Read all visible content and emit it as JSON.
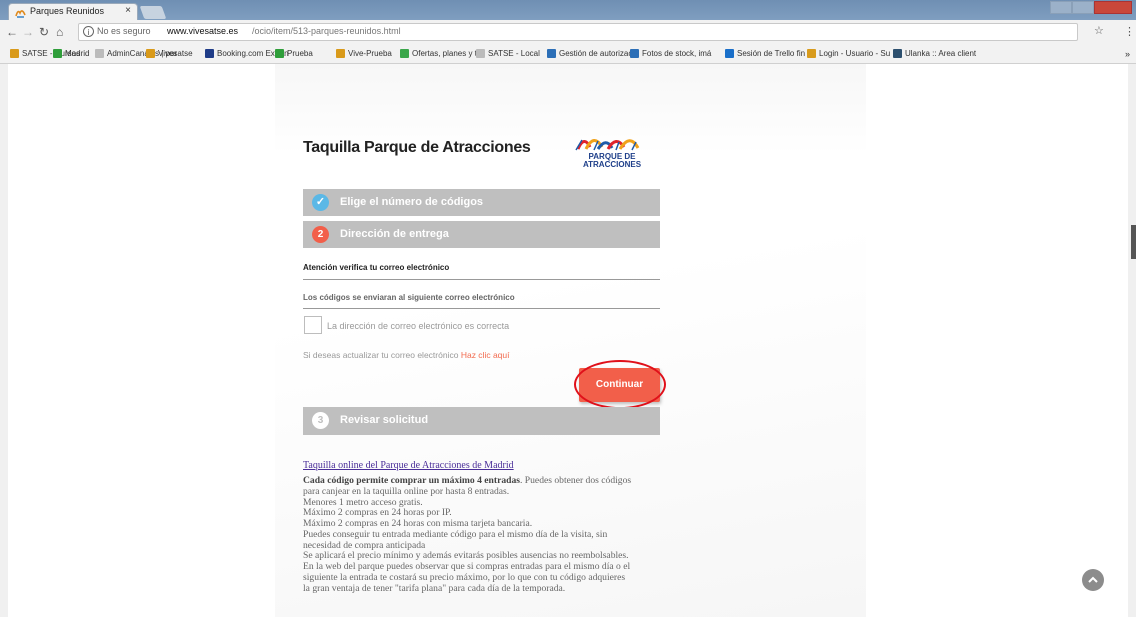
{
  "browser": {
    "tab_title": "Parques Reunidos",
    "tab_close": "×",
    "url_security": "No es seguro",
    "url_host": "www.vivesatse.es",
    "url_path": "/ocio/item/513-parques-reunidos.html",
    "bookmarks": [
      {
        "label": "SATSE - Cursos",
        "color": "#d99a1a"
      },
      {
        "label": "Madrid",
        "color": "#2f9e3a"
      },
      {
        "label": "AdminCanales | por",
        "color": "#bbbbbb"
      },
      {
        "label": "Vivesatse",
        "color": "#d99a1a"
      },
      {
        "label": "Booking.com Extran",
        "color": "#1f3c88"
      },
      {
        "label": "Prueba",
        "color": "#2f9e3a"
      },
      {
        "label": "Vive-Prueba",
        "color": "#d99a1a"
      },
      {
        "label": "Ofertas, planes y tu",
        "color": "#3aa64a"
      },
      {
        "label": "SATSE - Local",
        "color": "#bbbbbb"
      },
      {
        "label": "Gestión de autorizac",
        "color": "#2c6fb7"
      },
      {
        "label": "Fotos de stock, imá",
        "color": "#2c6fb7"
      },
      {
        "label": "Sesión de Trello fin",
        "color": "#1a6fc9"
      },
      {
        "label": "Login - Usuario - Su",
        "color": "#d89b1c"
      },
      {
        "label": "Ulanka :: Area client",
        "color": "#2c4f6e"
      }
    ],
    "bookmarks_more": "»"
  },
  "page": {
    "title": "Taquilla Parque de Atracciones",
    "logo_text_1": "PARQUE DE",
    "logo_text_2": "ATRACCIONES",
    "step1": {
      "number": "✓",
      "label": "Elige el número de códigos"
    },
    "step2": {
      "number": "2",
      "label": "Dirección de entrega"
    },
    "step3": {
      "number": "3",
      "label": "Revisar solicitud"
    },
    "attention_label": "Atención verifica tu correo electrónico",
    "email_label": "Los códigos se enviaran al siguiente correo electrónico",
    "checkbox_label": "La dirección de correo electrónico es correcta",
    "update_text": "Si deseas actualizar tu correo electrónico",
    "update_link": "Haz clic aquí",
    "continue_label": "Continuar",
    "info_link": "Taquilla online del Parque de Atracciones de Madrid",
    "info_bold": "Cada código permite comprar un máximo 4 entradas",
    "info_line1_rest": ". Puedes obtener dos códigos",
    "info_lines": [
      "para canjear en la taquilla online por hasta 8 entradas.",
      "Menores 1 metro acceso gratis.",
      "Máximo 2 compras en 24 horas por IP.",
      "Máximo 2 compras en 24 horas con misma tarjeta bancaria.",
      "Puedes conseguir tu entrada mediante código para el mismo día de la visita, sin",
      "necesidad de compra anticipada",
      "Se aplicará el precio mínimo y además evitarás posibles ausencias no reembolsables.",
      "En la web del parque puedes observar que si compras entradas para el mismo día o el",
      "siguiente la entrada te costará su precio máximo, por lo que con tu código adquieres",
      "la gran ventaja de tener \"tarifa plana\" para cada día de la temporada."
    ]
  },
  "colors": {
    "accent": "#f25f4a",
    "step_bg": "#bfbfbf",
    "step_done": "#5bb8e6",
    "highlight": "#e0101a"
  }
}
